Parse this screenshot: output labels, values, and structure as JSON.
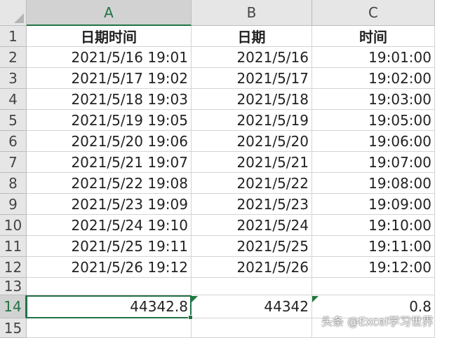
{
  "columns": [
    "A",
    "B",
    "C"
  ],
  "header_row": [
    "日期时间",
    "日期",
    "时间"
  ],
  "rows": [
    {
      "n": "2",
      "a": "2021/5/16 19:01",
      "b": "2021/5/16",
      "c": "19:01:00"
    },
    {
      "n": "3",
      "a": "2021/5/17 19:02",
      "b": "2021/5/17",
      "c": "19:02:00"
    },
    {
      "n": "4",
      "a": "2021/5/18 19:03",
      "b": "2021/5/18",
      "c": "19:03:00"
    },
    {
      "n": "5",
      "a": "2021/5/19 19:05",
      "b": "2021/5/19",
      "c": "19:05:00"
    },
    {
      "n": "6",
      "a": "2021/5/20 19:06",
      "b": "2021/5/20",
      "c": "19:06:00"
    },
    {
      "n": "7",
      "a": "2021/5/21 19:07",
      "b": "2021/5/21",
      "c": "19:07:00"
    },
    {
      "n": "8",
      "a": "2021/5/22 19:08",
      "b": "2021/5/22",
      "c": "19:08:00"
    },
    {
      "n": "9",
      "a": "2021/5/23 19:09",
      "b": "2021/5/23",
      "c": "19:09:00"
    },
    {
      "n": "10",
      "a": "2021/5/24 19:10",
      "b": "2021/5/24",
      "c": "19:10:00"
    },
    {
      "n": "11",
      "a": "2021/5/25 19:11",
      "b": "2021/5/25",
      "c": "19:11:00"
    },
    {
      "n": "12",
      "a": "2021/5/26 19:12",
      "b": "2021/5/26",
      "c": "19:12:00"
    }
  ],
  "row_numbers": {
    "r1": "1",
    "r13": "13",
    "r14": "14",
    "r15": "15"
  },
  "row14": {
    "a": "44342.8",
    "b": "44342",
    "c": "0.8"
  },
  "selected_cell": "A14",
  "watermark": "头条 @Excel学习世界",
  "colors": {
    "accent": "#217346",
    "header_bg": "#e6e6e6",
    "gridline": "#d4d4d4"
  }
}
